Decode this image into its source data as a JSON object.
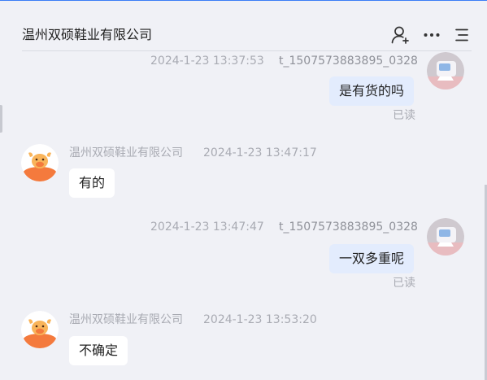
{
  "header": {
    "title": "温州双硕鞋业有限公司",
    "icons": [
      "add-contact-icon",
      "more-icon",
      "menu-icon"
    ]
  },
  "messages": [
    {
      "direction": "outgoing",
      "timestamp": "2024-1-23 13:37:53",
      "sender": "t_1507573883895_0328",
      "text": "是有货的吗",
      "status": "已读"
    },
    {
      "direction": "incoming",
      "sender": "温州双硕鞋业有限公司",
      "timestamp": "2024-1-23 13:47:17",
      "text": "有的"
    },
    {
      "direction": "outgoing",
      "timestamp": "2024-1-23 13:47:47",
      "sender": "t_1507573883895_0328",
      "text": "一双多重呢",
      "status": "已读"
    },
    {
      "direction": "incoming",
      "sender": "温州双硕鞋业有限公司",
      "timestamp": "2024-1-23 13:53:20",
      "text": "不确定"
    }
  ],
  "colors": {
    "background": "#f0f1f6",
    "outgoing_bubble": "#e3ecfd",
    "incoming_bubble": "#ffffff",
    "accent_border": "#3b7ef6",
    "meta_text": "#a9abb3",
    "seller_avatar_orange": "#f47a3d"
  }
}
